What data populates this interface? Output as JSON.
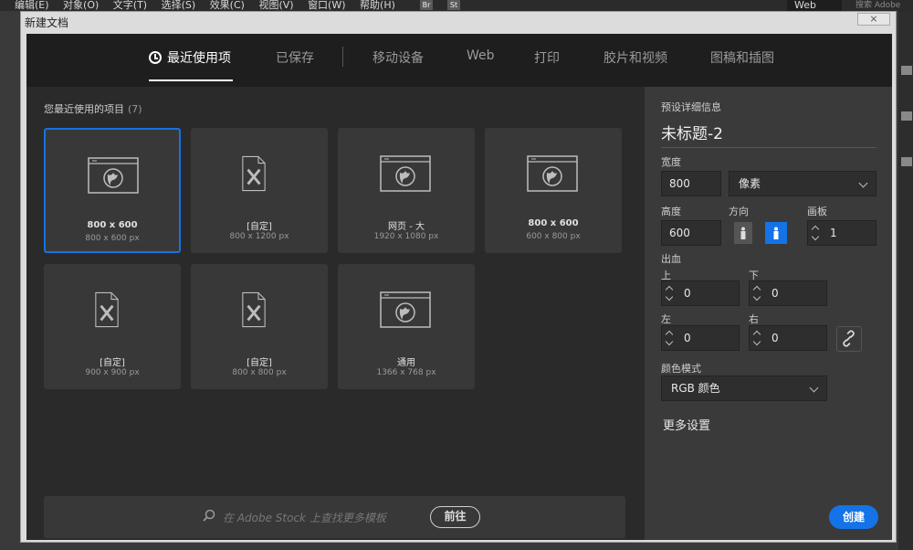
{
  "menubar": {
    "items": [
      "编辑(E)",
      "对象(O)",
      "文字(T)",
      "选择(S)",
      "效果(C)",
      "视图(V)",
      "窗口(W)",
      "帮助(H)"
    ],
    "br_icon": "Br",
    "st_icon": "St",
    "workspace": "Web",
    "search_placeholder": "搜索 Adobe"
  },
  "dialog": {
    "title": "新建文档",
    "close_symbol": "⨯"
  },
  "tabs": [
    {
      "label": "最近使用项",
      "active": true
    },
    {
      "label": "已保存"
    },
    {
      "label": "移动设备"
    },
    {
      "label": "Web"
    },
    {
      "label": "打印"
    },
    {
      "label": "胶片和视频"
    },
    {
      "label": "图稿和插图"
    }
  ],
  "recent": {
    "title": "您最近使用的项目",
    "count": "(7)",
    "items": [
      {
        "name": "800 x 600",
        "size": "800 x 600 px",
        "icon": "web-document-icon",
        "selected": true
      },
      {
        "name": "[自定]",
        "size": "800 x 1200 px",
        "icon": "custom-document-icon"
      },
      {
        "name": "网页 - 大",
        "size": "1920 x 1080 px",
        "icon": "web-document-icon"
      },
      {
        "name": "800 x 600",
        "size": "600 x 800 px",
        "icon": "web-document-icon"
      },
      {
        "name": "[自定]",
        "size": "900 x 900 px",
        "icon": "custom-document-icon"
      },
      {
        "name": "[自定]",
        "size": "800 x 800 px",
        "icon": "custom-document-icon"
      },
      {
        "name": "通用",
        "size": "1366 x 768 px",
        "icon": "web-document-icon"
      }
    ]
  },
  "stock": {
    "placeholder": "在 Adobe Stock 上查找更多模板",
    "go_label": "前往"
  },
  "preset": {
    "section_label": "预设详细信息",
    "doc_name": "未标题-2",
    "width_label": "宽度",
    "width": "800",
    "unit": "像素",
    "height_label": "高度",
    "height": "600",
    "orientation_label": "方向",
    "artboards_label": "画板",
    "artboards": "1",
    "bleed_label": "出血",
    "top_label": "上",
    "top": "0",
    "bottom_label": "下",
    "bottom": "0",
    "left_label": "左",
    "left": "0",
    "right_label": "右",
    "right": "0",
    "color_mode_label": "颜色模式",
    "color_mode": "RGB 颜色",
    "more_settings": "更多设置",
    "create_label": "创建"
  },
  "colors": {
    "accent": "#1473e6"
  }
}
